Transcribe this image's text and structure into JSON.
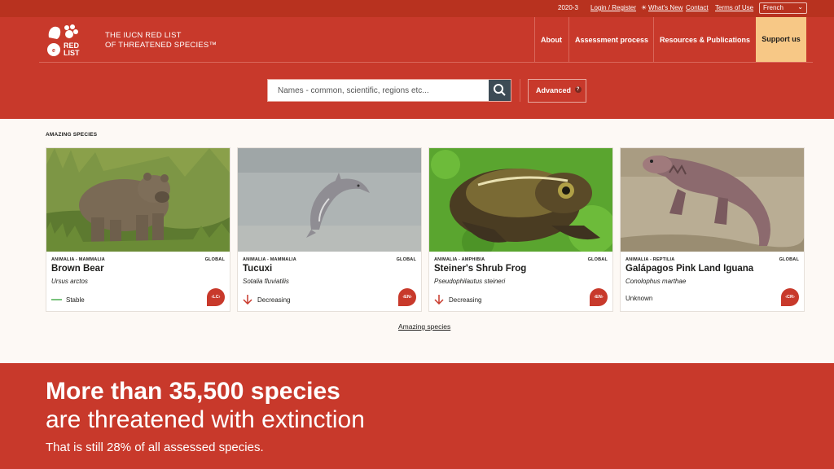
{
  "topbar": {
    "version": "2020-3",
    "login": "Login / Register",
    "whats_new": "What's New",
    "contact": "Contact",
    "terms": "Terms of Use",
    "language": "French"
  },
  "brand": {
    "logo_text_1": "RED",
    "logo_text_2": "LIST",
    "title_line1": "THE IUCN RED LIST",
    "title_line2": "OF THREATENED SPECIES™"
  },
  "nav": {
    "about": "About",
    "assessment": "Assessment process",
    "resources": "Resources & Publications",
    "support": "Support us"
  },
  "search": {
    "placeholder": "Names - common, scientific, regions etc...",
    "advanced_label": "Advanced",
    "help_mark": "?"
  },
  "species": {
    "section_label": "AMAZING SPECIES",
    "cards": [
      {
        "taxonomy": "ANIMALIA - MAMMALIA",
        "scope": "GLOBAL",
        "common_name": "Brown Bear",
        "scientific_name": "Ursus arctos",
        "trend": "Stable",
        "trend_icon": "stable-line-icon",
        "category": "‹LC›"
      },
      {
        "taxonomy": "ANIMALIA - MAMMALIA",
        "scope": "GLOBAL",
        "common_name": "Tucuxi",
        "scientific_name": "Sotalia fluviatilis",
        "trend": "Decreasing",
        "trend_icon": "arrow-down-icon",
        "category": "‹EN›"
      },
      {
        "taxonomy": "ANIMALIA - AMPHIBIA",
        "scope": "GLOBAL",
        "common_name": "Steiner's Shrub Frog",
        "scientific_name": "Pseudophilautus steineri",
        "trend": "Decreasing",
        "trend_icon": "arrow-down-icon",
        "category": "‹EN›"
      },
      {
        "taxonomy": "ANIMALIA - REPTILIA",
        "scope": "GLOBAL",
        "common_name": "Galápagos Pink Land Iguana",
        "scientific_name": "Conolophus marthae",
        "trend": "Unknown",
        "trend_icon": "",
        "category": "‹CR›"
      }
    ],
    "more_link": "Amazing species"
  },
  "stats": {
    "headline": "More than 35,500 species",
    "subheadline": "are threatened with extinction",
    "detail": "That is still 28% of all assessed species."
  },
  "colors": {
    "brand_red": "#c8392b",
    "topbar_red": "#b8321f",
    "support_bg": "#f7c886",
    "search_button": "#3d4b55",
    "stable_green": "#4caf50"
  }
}
